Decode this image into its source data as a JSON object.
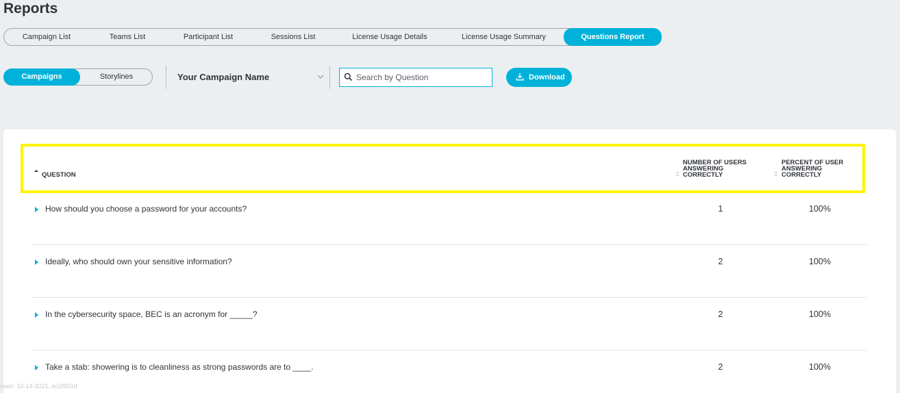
{
  "page": {
    "title": "Reports"
  },
  "tabs": [
    {
      "label": "Campaign List"
    },
    {
      "label": "Teams List"
    },
    {
      "label": "Participant List"
    },
    {
      "label": "Sessions List"
    },
    {
      "label": "License Usage Details"
    },
    {
      "label": "License Usage Summary"
    },
    {
      "label": "Questions Report",
      "active": true
    }
  ],
  "toggle": {
    "campaigns": "Campaigns",
    "storylines": "Storylines"
  },
  "campaign_select": {
    "value": "Your Campaign Name"
  },
  "search": {
    "placeholder": "Search by Question",
    "value": ""
  },
  "download": {
    "label": "Download"
  },
  "table": {
    "headers": {
      "question": "QUESTION",
      "users_correct": [
        "NUMBER OF USERS",
        "ANSWERING",
        "CORRECTLY"
      ],
      "percent_correct": [
        "PERCENT OF USER",
        "ANSWERING",
        "CORRECTLY"
      ]
    },
    "rows": [
      {
        "question": "How should you choose a password for your accounts?",
        "users": "1",
        "percent": "100%"
      },
      {
        "question": "Ideally, who should own your sensitive information?",
        "users": "2",
        "percent": "100%"
      },
      {
        "question": "In the cybersecurity space, BEC is an acronym for _____?",
        "users": "2",
        "percent": "100%"
      },
      {
        "question": "Take a stab: showering is to cleanliness as strong passwords are to ____.",
        "users": "2",
        "percent": "100%"
      }
    ]
  },
  "footer": {
    "version": "rsion: 10-14-2021, ec2f991d"
  },
  "colors": {
    "accent": "#00b2d9",
    "highlight": "#fff500",
    "background": "#eceff2"
  },
  "icons": {
    "search": "search-icon",
    "download": "download-icon",
    "dropdown": "chevron-down-icon",
    "expand": "caret-right-icon",
    "sort": "sort-icon"
  }
}
